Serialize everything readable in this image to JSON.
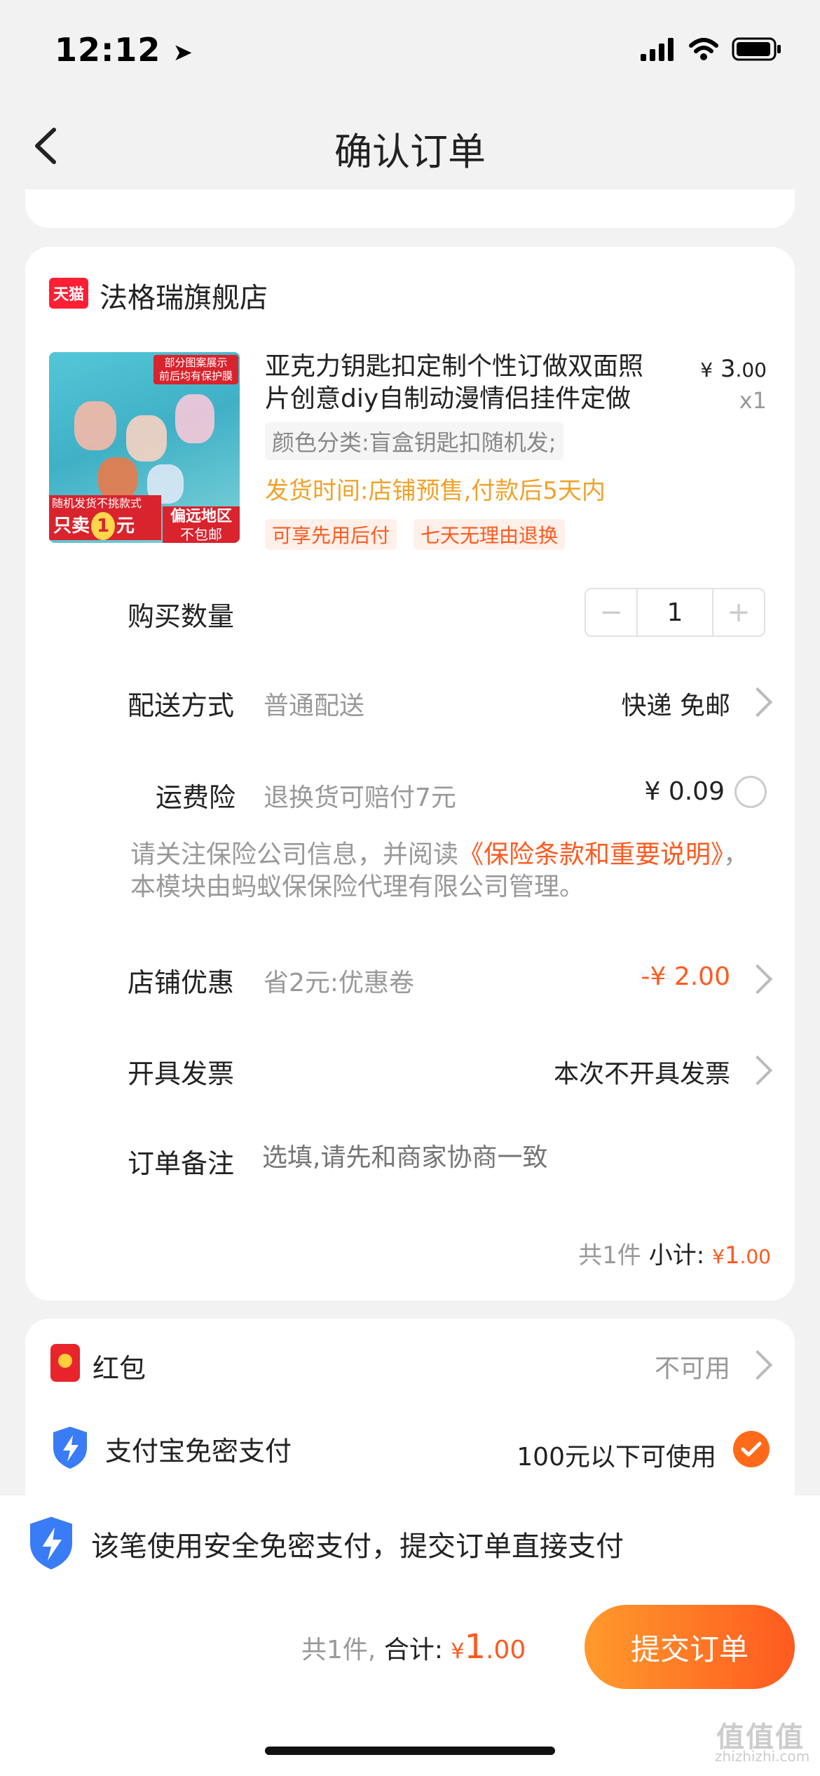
{
  "status": {
    "time": "12:12"
  },
  "nav": {
    "title": "确认订单"
  },
  "shop": {
    "badge": "天猫",
    "name": "法格瑞旗舰店"
  },
  "product": {
    "title": "亚克力钥匙扣定制个性订做双面照片创意diy自制动漫情侣挂件定做",
    "price_symbol": "¥",
    "price_int": "3",
    "price_dec": ".00",
    "qty": "x1",
    "sku": "颜色分类:盲盒钥匙扣随机发;",
    "ship_time": "发货时间:店铺预售,付款后5天内",
    "tags": [
      "可享先用后付",
      "七天无理由退换"
    ],
    "image_text": {
      "top1": "部分图案展示",
      "top2": "前后均有保护膜",
      "bl1": "随机发货不挑款式",
      "bl2": "只卖",
      "bl3": "1",
      "bl4": "元",
      "br1": "偏远地区",
      "br2": "不包邮"
    }
  },
  "rows": {
    "quantity": {
      "label": "购买数量",
      "value": "1",
      "minus": "−",
      "plus": "+"
    },
    "delivery": {
      "label": "配送方式",
      "sub": "普通配送",
      "value": "快递 免邮"
    },
    "insurance": {
      "label": "运费险",
      "sub": "退换货可赔付7元",
      "value": "¥ 0.09"
    },
    "notice": {
      "prefix": "请关注保险公司信息，并阅读",
      "link": "《保险条款和重要说明》",
      "suffix": "，本模块由蚂蚁保保险代理有限公司管理。"
    },
    "discount": {
      "label": "店铺优惠",
      "sub": "省2元:优惠卷",
      "value": "-¥ 2.00"
    },
    "invoice": {
      "label": "开具发票",
      "value": "本次不开具发票"
    },
    "remark": {
      "label": "订单备注",
      "placeholder": "选填,请先和商家协商一致"
    }
  },
  "subtotal": {
    "count": "共1件",
    "label": "小计:",
    "symbol": "¥",
    "int": "1",
    "dec": ".00"
  },
  "payment": {
    "redpacket": {
      "label": "红包",
      "value": "不可用"
    },
    "alipay": {
      "label": "支付宝免密支付",
      "value": "100元以下可使用"
    }
  },
  "bottom": {
    "note": "该笔使用安全免密支付，提交订单直接支付",
    "count": "共1件,",
    "total_label": "合计:",
    "symbol": "¥",
    "int": "1",
    "dec": ".00",
    "submit": "提交订单"
  },
  "watermark": {
    "main": "值值值",
    "sub": "zhizhizhi.com"
  },
  "colors": {
    "accent": "#ff5a1f",
    "gold": "#f0a22a",
    "tmall": "#ff1f35",
    "shield": "#3a7bf6"
  }
}
